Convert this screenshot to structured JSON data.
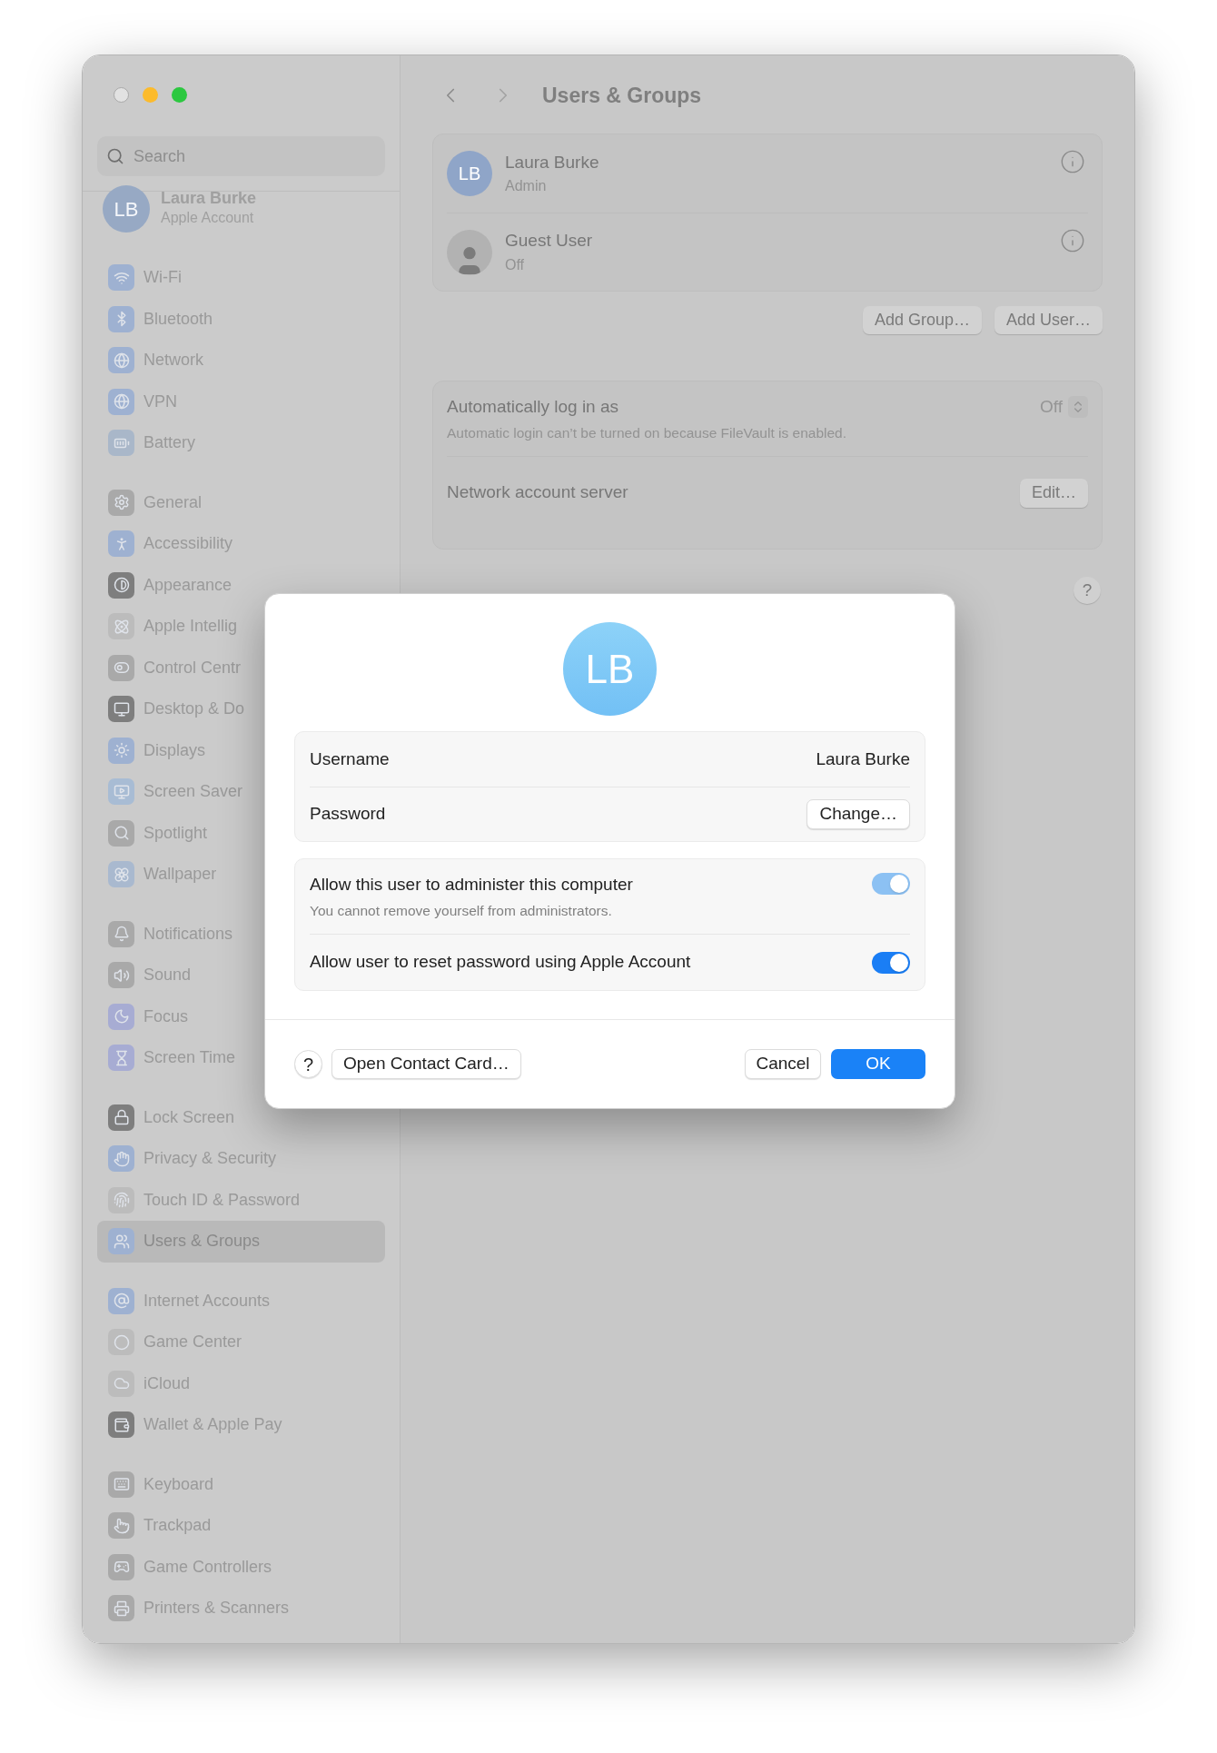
{
  "sidebar": {
    "search": {
      "placeholder": "Search"
    },
    "account": {
      "initials": "LB",
      "name": "Laura Burke",
      "subtitle": "Apple Account"
    },
    "groups": [
      {
        "items": [
          {
            "label": "Wi-Fi",
            "color": "#9eb1d1",
            "selected": false
          },
          {
            "label": "Bluetooth",
            "color": "#9eb1d1",
            "selected": false
          },
          {
            "label": "Network",
            "color": "#9eb1d1",
            "selected": false
          },
          {
            "label": "VPN",
            "color": "#9eb1d1",
            "selected": false
          },
          {
            "label": "Battery",
            "color": "#a9b7c9",
            "selected": false
          }
        ]
      },
      {
        "items": [
          {
            "label": "General",
            "color": "#a9a9a9",
            "selected": false
          },
          {
            "label": "Accessibility",
            "color": "#9eb1d1",
            "selected": false
          },
          {
            "label": "Appearance",
            "color": "#7e7e7e",
            "selected": false
          },
          {
            "label": "Apple Intellig",
            "color": "#bcbcbc",
            "selected": false
          },
          {
            "label": "Control Centr",
            "color": "#a9a9a9",
            "selected": false
          },
          {
            "label": "Desktop & Do",
            "color": "#7e7e7e",
            "selected": false
          },
          {
            "label": "Displays",
            "color": "#9eb1d1",
            "selected": false
          },
          {
            "label": "Screen Saver",
            "color": "#a8bcd4",
            "selected": false
          },
          {
            "label": "Spotlight",
            "color": "#a9a9a9",
            "selected": false
          },
          {
            "label": "Wallpaper",
            "color": "#a9b9cf",
            "selected": false
          }
        ]
      },
      {
        "items": [
          {
            "label": "Notifications",
            "color": "#a9a9a9",
            "selected": false
          },
          {
            "label": "Sound",
            "color": "#a9a9a9",
            "selected": false
          },
          {
            "label": "Focus",
            "color": "#a7acd3",
            "selected": false
          },
          {
            "label": "Screen Time",
            "color": "#a7acd3",
            "selected": false
          }
        ]
      },
      {
        "items": [
          {
            "label": "Lock Screen",
            "color": "#7e7e7e",
            "selected": false
          },
          {
            "label": "Privacy & Security",
            "color": "#9eb1d1",
            "selected": false
          },
          {
            "label": "Touch ID & Password",
            "color": "#bcbcbc",
            "selected": false
          },
          {
            "label": "Users & Groups",
            "color": "#9eb1d1",
            "selected": true
          }
        ]
      },
      {
        "items": [
          {
            "label": "Internet Accounts",
            "color": "#9eb1d1",
            "selected": false
          },
          {
            "label": "Game Center",
            "color": "#bcbcbc",
            "selected": false
          },
          {
            "label": "iCloud",
            "color": "#bcbcbc",
            "selected": false
          },
          {
            "label": "Wallet & Apple Pay",
            "color": "#7e7e7e",
            "selected": false
          }
        ]
      },
      {
        "items": [
          {
            "label": "Keyboard",
            "color": "#a9a9a9",
            "selected": false
          },
          {
            "label": "Trackpad",
            "color": "#a9a9a9",
            "selected": false
          },
          {
            "label": "Game Controllers",
            "color": "#a9a9a9",
            "selected": false
          },
          {
            "label": "Printers & Scanners",
            "color": "#a9a9a9",
            "selected": false
          }
        ]
      }
    ]
  },
  "main": {
    "title": "Users & Groups",
    "users": [
      {
        "kind": "initials",
        "initials": "LB",
        "name": "Laura Burke",
        "role": "Admin"
      },
      {
        "kind": "guest",
        "name": "Guest User",
        "role": "Off"
      }
    ],
    "buttons": [
      "Add Group…",
      "Add User…"
    ],
    "settings": [
      {
        "kind": "popup",
        "label": "Automatically log in as",
        "note": "Automatic login can’t be turned on because FileVault is enabled.",
        "value": "Off",
        "disabled": true
      },
      {
        "kind": "button",
        "label": "Network account server",
        "button": "Edit…"
      }
    ],
    "help": "?"
  },
  "dialog": {
    "avatar": "LB",
    "fields": [
      {
        "kind": "text",
        "label": "Username",
        "value": "Laura Burke"
      },
      {
        "kind": "button",
        "label": "Password",
        "button": "Change…"
      }
    ],
    "toggles": [
      {
        "label": "Allow this user to administer this computer",
        "note": "You cannot remove yourself from administrators.",
        "on": true,
        "disabled": true
      },
      {
        "label": "Allow user to reset password using Apple Account",
        "on": true,
        "disabled": false
      }
    ],
    "help": "?",
    "left_buttons": [
      "Open Contact Card…"
    ],
    "right_buttons": [
      {
        "label": "Cancel",
        "kind": "secondary"
      },
      {
        "label": "OK",
        "kind": "default"
      }
    ]
  }
}
